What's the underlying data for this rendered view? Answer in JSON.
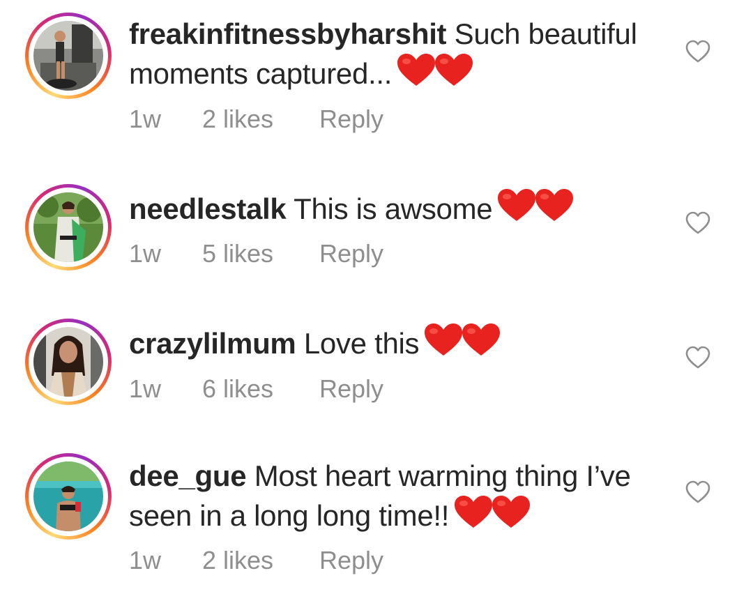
{
  "comments": [
    {
      "username": "freakinfitnessbyharshit",
      "text": "Such beautiful moments captured...",
      "time": "1w",
      "likes": "2 likes",
      "reply": "Reply",
      "emoji": "red-heart-x2"
    },
    {
      "username": "needlestalk",
      "text": "This is awsome",
      "time": "1w",
      "likes": "5 likes",
      "reply": "Reply",
      "emoji": "red-heart-x2"
    },
    {
      "username": "crazylilmum",
      "text": "Love this",
      "time": "1w",
      "likes": "6 likes",
      "reply": "Reply",
      "emoji": "red-heart-x2"
    },
    {
      "username": "dee_gue",
      "text": "Most heart warming thing I’ve seen in a long long time!!",
      "time": "1w",
      "likes": "2 likes",
      "reply": "Reply",
      "emoji": "red-heart-x2"
    }
  ],
  "colors": {
    "text": "#262626",
    "meta": "#8e8e8e",
    "heart": "#e8231f",
    "ring_start": "#feda75",
    "ring_end": "#d62976"
  }
}
